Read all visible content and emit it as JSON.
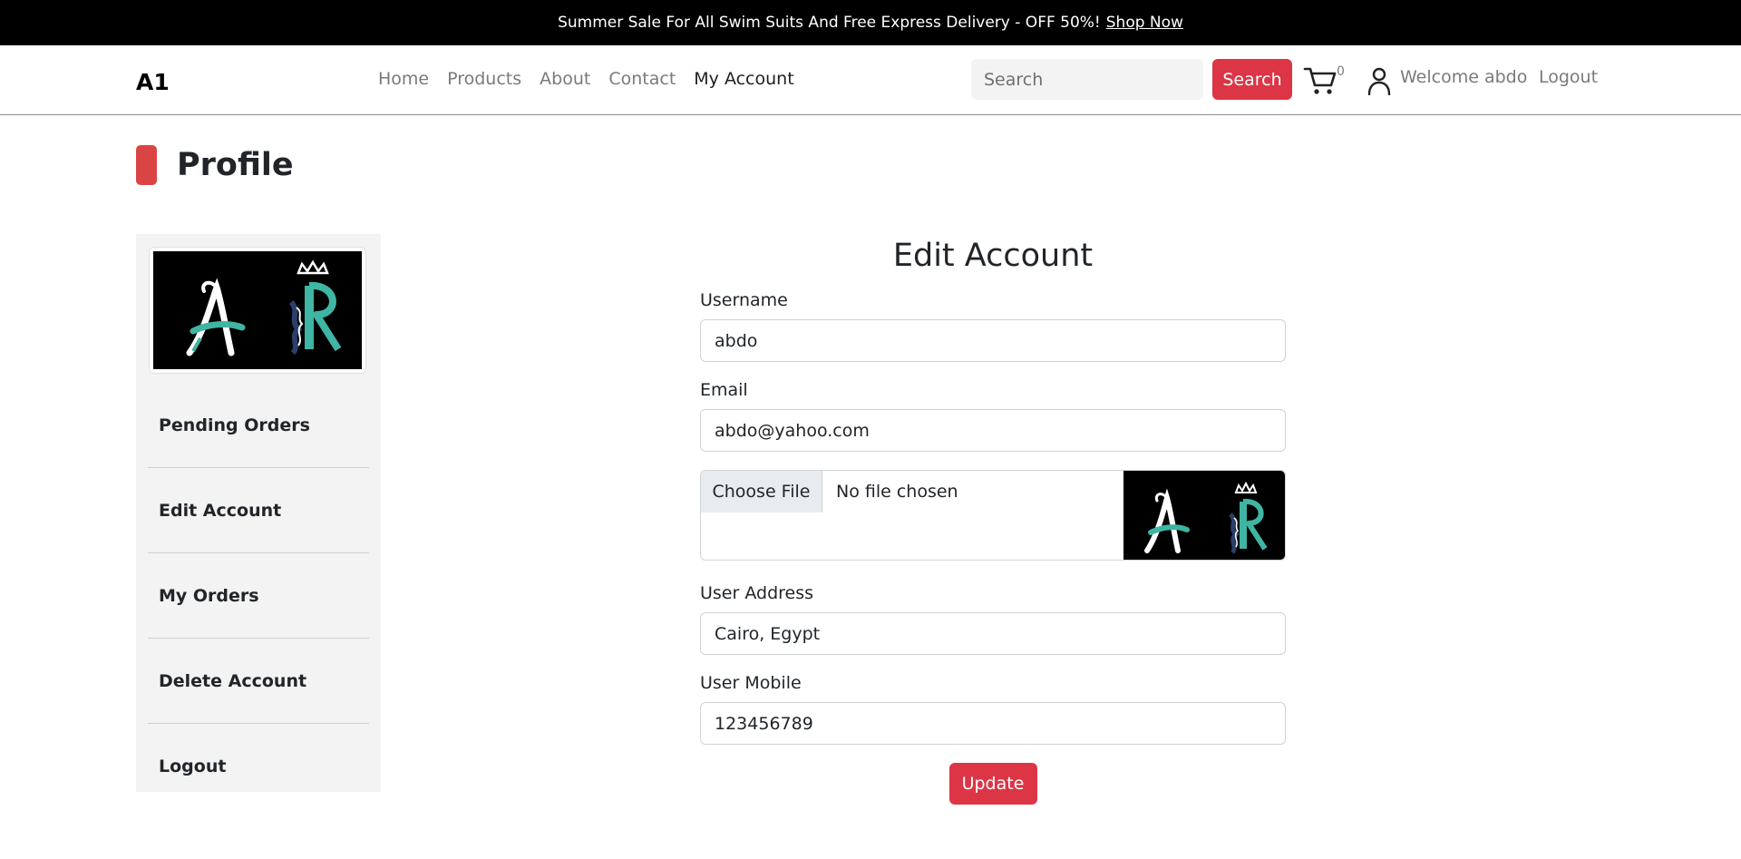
{
  "announcement": {
    "text": "Summer Sale For All Swim Suits And Free Express Delivery - OFF 50%!",
    "link": "Shop Now"
  },
  "nav": {
    "brand": "A1",
    "links": [
      "Home",
      "Products",
      "About",
      "Contact",
      "My Account"
    ],
    "active": "My Account",
    "search_placeholder": "Search",
    "search_button": "Search",
    "cart_count": "0",
    "welcome": "Welcome abdo",
    "logout": "Logout"
  },
  "page": {
    "title": "Profile"
  },
  "sidebar": {
    "items": [
      "Pending Orders",
      "Edit Account",
      "My Orders",
      "Delete Account",
      "Logout"
    ]
  },
  "form": {
    "title": "Edit Account",
    "username_label": "Username",
    "username_value": "abdo",
    "email_label": "Email",
    "email_value": "abdo@yahoo.com",
    "choose_file": "Choose File",
    "file_status": "No file chosen",
    "address_label": "User Address",
    "address_value": "Cairo, Egypt",
    "mobile_label": "User Mobile",
    "mobile_value": "123456789",
    "update_button": "Update"
  },
  "colors": {
    "accent": "#dc3545",
    "topbar": "#000000",
    "sidebar_bg": "#f3f3f3",
    "logo_teal": "#3fb5a3"
  }
}
